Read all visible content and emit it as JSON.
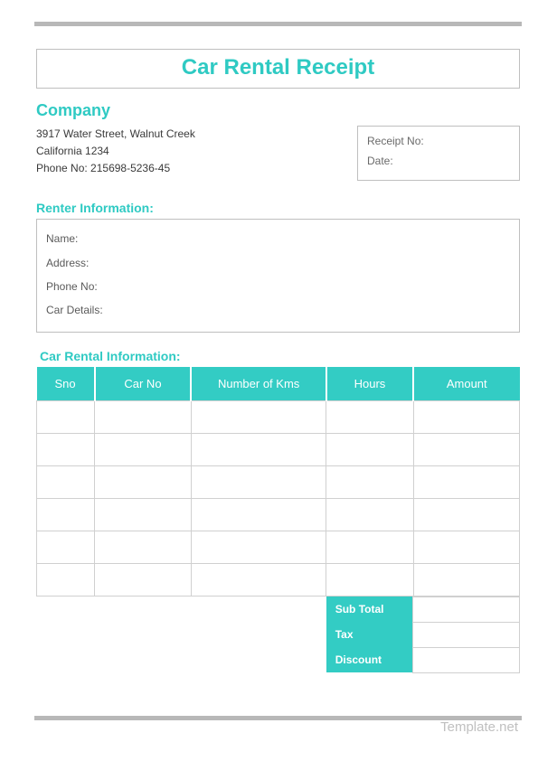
{
  "title": "Car Rental Receipt",
  "company": {
    "heading": "Company",
    "address_line1": "3917 Water Street, Walnut Creek",
    "address_line2": "California 1234",
    "phone_label": "Phone No: 215698-5236-45"
  },
  "receipt_box": {
    "receipt_no_label": "Receipt No:",
    "date_label": "Date:"
  },
  "renter": {
    "heading": "Renter Information:",
    "name_label": "Name:",
    "address_label": "Address:",
    "phone_label": "Phone No:",
    "car_details_label": "Car Details:"
  },
  "rental_info": {
    "heading": "Car Rental Information:",
    "columns": {
      "sno": "Sno",
      "carno": "Car No",
      "kms": "Number of Kms",
      "hours": "Hours",
      "amount": "Amount"
    },
    "rows": [
      "",
      "",
      "",
      "",
      "",
      ""
    ]
  },
  "summary": {
    "subtotal_label": "Sub Total",
    "tax_label": "Tax",
    "discount_label": "Discount"
  },
  "footer": {
    "brand": "Template.net"
  }
}
